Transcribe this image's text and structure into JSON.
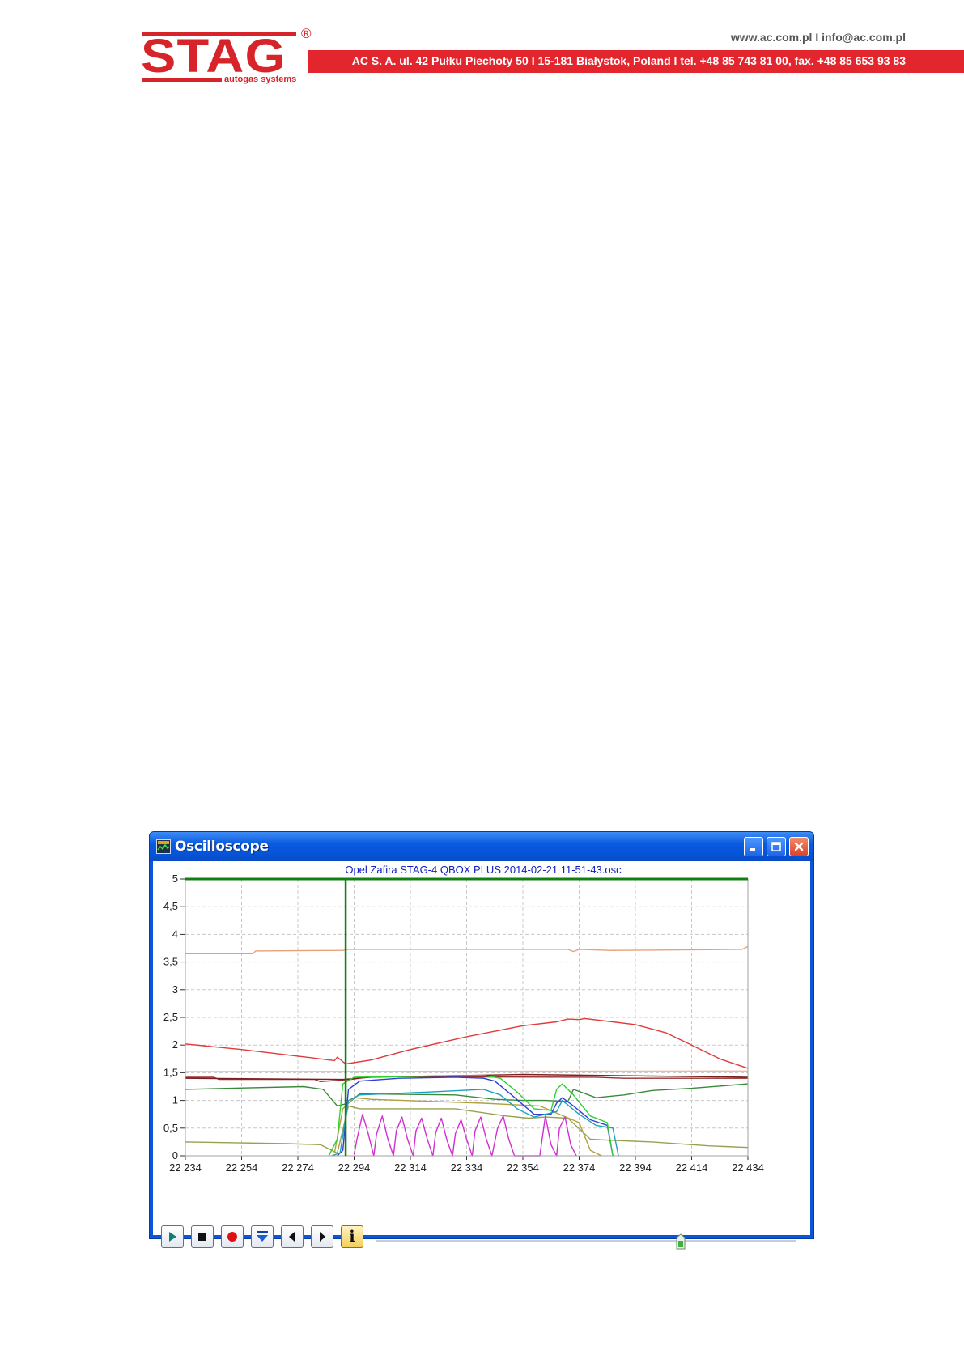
{
  "header": {
    "logo_text": "STAG",
    "logo_registered": "®",
    "logo_tagline": "autogas systems",
    "contact_line": "www.ac.com.pl I info@ac.com.pl",
    "address_line": "AC S. A. ul. 42 Pułku Piechoty 50 I 15-181 Białystok, Poland I tel. +48 85 743 81 00, fax. +48 85 653 93 83",
    "brand_color": "#e3262e"
  },
  "window": {
    "title": "Oscilloscope",
    "icon": "oscilloscope-app-icon",
    "buttons": [
      "minimize-icon",
      "maximize-icon",
      "close-icon"
    ]
  },
  "toolbar": {
    "icons": [
      "play-icon",
      "stop-icon",
      "record-icon",
      "download-icon",
      "step-back-icon",
      "step-forward-icon",
      "info-icon"
    ],
    "info_label": "i",
    "position_fraction": 0.725
  },
  "chart_data": {
    "type": "line",
    "title": "Opel Zafira STAG-4 QBOX PLUS 2014-02-21 11-51-43.osc",
    "xlim": [
      22234,
      22434
    ],
    "ylim": [
      0,
      5
    ],
    "x_ticks": [
      "22 234",
      "22 254",
      "22 274",
      "22 294",
      "22 314",
      "22 334",
      "22 354",
      "22 374",
      "22 394",
      "22 414",
      "22 434"
    ],
    "x_tick_values": [
      22234,
      22254,
      22274,
      22294,
      22314,
      22334,
      22354,
      22374,
      22394,
      22414,
      22434
    ],
    "y_ticks": [
      "0",
      "0,5",
      "1",
      "1,5",
      "2",
      "2,5",
      "3",
      "3,5",
      "4",
      "4,5",
      "5"
    ],
    "y_tick_values": [
      0,
      0.5,
      1,
      1.5,
      2,
      2.5,
      3,
      3.5,
      4,
      4.5,
      5
    ],
    "grid": true,
    "cursor_x": 22291,
    "series": [
      {
        "color": "#e8a078",
        "points": [
          [
            22234,
            3.65
          ],
          [
            22258,
            3.65
          ],
          [
            22259,
            3.7
          ],
          [
            22290,
            3.71
          ],
          [
            22292,
            3.73
          ],
          [
            22370,
            3.73
          ],
          [
            22372,
            3.69
          ],
          [
            22374,
            3.73
          ],
          [
            22385,
            3.71
          ],
          [
            22410,
            3.72
          ],
          [
            22432,
            3.73
          ],
          [
            22434,
            3.78
          ]
        ]
      },
      {
        "color": "#f0b8a0",
        "points": [
          [
            22234,
            1.52
          ],
          [
            22434,
            1.53
          ]
        ]
      },
      {
        "color": "#e03a3a",
        "points": [
          [
            22234,
            2.02
          ],
          [
            22254,
            1.92
          ],
          [
            22274,
            1.8
          ],
          [
            22287,
            1.72
          ],
          [
            22288,
            1.78
          ],
          [
            22291,
            1.66
          ],
          [
            22300,
            1.73
          ],
          [
            22314,
            1.92
          ],
          [
            22334,
            2.15
          ],
          [
            22354,
            2.35
          ],
          [
            22366,
            2.42
          ],
          [
            22370,
            2.47
          ],
          [
            22374,
            2.46
          ],
          [
            22376,
            2.48
          ],
          [
            22394,
            2.37
          ],
          [
            22405,
            2.22
          ],
          [
            22414,
            2.0
          ],
          [
            22424,
            1.75
          ],
          [
            22434,
            1.58
          ]
        ]
      },
      {
        "color": "#9a3030",
        "points": [
          [
            22234,
            1.42
          ],
          [
            22244,
            1.42
          ],
          [
            22246,
            1.38
          ],
          [
            22280,
            1.38
          ],
          [
            22282,
            1.34
          ],
          [
            22293,
            1.38
          ],
          [
            22300,
            1.43
          ],
          [
            22380,
            1.42
          ],
          [
            22390,
            1.4
          ],
          [
            22434,
            1.4
          ]
        ]
      },
      {
        "color": "#7a2020",
        "points": [
          [
            22234,
            1.4
          ],
          [
            22290,
            1.38
          ],
          [
            22300,
            1.42
          ],
          [
            22354,
            1.47
          ],
          [
            22400,
            1.44
          ],
          [
            22434,
            1.42
          ]
        ]
      },
      {
        "color": "#3a8a3a",
        "points": [
          [
            22234,
            1.2
          ],
          [
            22250,
            1.22
          ],
          [
            22276,
            1.25
          ],
          [
            22283,
            1.2
          ],
          [
            22288,
            0.9
          ],
          [
            22292,
            0.95
          ],
          [
            22296,
            1.12
          ],
          [
            22330,
            1.1
          ],
          [
            22344,
            1.02
          ],
          [
            22354,
            1.0
          ],
          [
            22362,
            1.0
          ],
          [
            22370,
            0.98
          ],
          [
            22372,
            1.2
          ],
          [
            22380,
            1.05
          ],
          [
            22390,
            1.1
          ],
          [
            22400,
            1.18
          ],
          [
            22414,
            1.22
          ],
          [
            22434,
            1.3
          ]
        ]
      },
      {
        "color": "#9aa050",
        "points": [
          [
            22234,
            0.25
          ],
          [
            22270,
            0.22
          ],
          [
            22282,
            0.2
          ],
          [
            22288,
            0.05
          ],
          [
            22292,
            0.9
          ],
          [
            22296,
            0.85
          ],
          [
            22330,
            0.85
          ],
          [
            22348,
            0.72
          ],
          [
            22356,
            0.68
          ],
          [
            22362,
            0.7
          ],
          [
            22370,
            0.68
          ],
          [
            22378,
            0.3
          ],
          [
            22385,
            0.28
          ],
          [
            22400,
            0.25
          ],
          [
            22420,
            0.18
          ],
          [
            22434,
            0.15
          ]
        ]
      },
      {
        "color": "#b0a040",
        "points": [
          [
            22287,
            0.05
          ],
          [
            22290,
            0.85
          ],
          [
            22294,
            1.05
          ],
          [
            22300,
            1.02
          ],
          [
            22340,
            0.95
          ],
          [
            22360,
            0.9
          ],
          [
            22374,
            0.6
          ],
          [
            22378,
            0.1
          ],
          [
            22382,
            0.0
          ]
        ]
      },
      {
        "color": "#2a40d8",
        "points": [
          [
            22288,
            0.0
          ],
          [
            22290,
            0.1
          ],
          [
            22292,
            1.2
          ],
          [
            22296,
            1.35
          ],
          [
            22310,
            1.4
          ],
          [
            22330,
            1.42
          ],
          [
            22340,
            1.4
          ],
          [
            22344,
            1.35
          ],
          [
            22350,
            1.1
          ],
          [
            22358,
            0.75
          ],
          [
            22364,
            0.75
          ],
          [
            22366,
            0.95
          ],
          [
            22368,
            1.05
          ],
          [
            22372,
            0.9
          ],
          [
            22378,
            0.65
          ],
          [
            22384,
            0.55
          ],
          [
            22386,
            0.0
          ]
        ]
      },
      {
        "color": "#1fa0c0",
        "points": [
          [
            22286,
            0.0
          ],
          [
            22289,
            0.05
          ],
          [
            22292,
            1.0
          ],
          [
            22296,
            1.1
          ],
          [
            22320,
            1.15
          ],
          [
            22340,
            1.2
          ],
          [
            22346,
            1.1
          ],
          [
            22352,
            0.85
          ],
          [
            22358,
            0.7
          ],
          [
            22366,
            0.8
          ],
          [
            22368,
            1.0
          ],
          [
            22374,
            0.75
          ],
          [
            22380,
            0.55
          ],
          [
            22386,
            0.5
          ],
          [
            22388,
            0.0
          ]
        ]
      },
      {
        "color": "#30d030",
        "points": [
          [
            22285,
            0.0
          ],
          [
            22288,
            0.3
          ],
          [
            22290,
            1.3
          ],
          [
            22294,
            1.42
          ],
          [
            22310,
            1.43
          ],
          [
            22330,
            1.45
          ],
          [
            22340,
            1.45
          ],
          [
            22346,
            1.4
          ],
          [
            22352,
            1.15
          ],
          [
            22358,
            0.85
          ],
          [
            22364,
            0.82
          ],
          [
            22366,
            1.2
          ],
          [
            22368,
            1.3
          ],
          [
            22372,
            1.1
          ],
          [
            22378,
            0.72
          ],
          [
            22384,
            0.6
          ],
          [
            22386,
            0.0
          ]
        ]
      },
      {
        "color": "#d030d0",
        "points": [
          [
            22294,
            0.02
          ],
          [
            22295,
            0.3
          ],
          [
            22297,
            0.75
          ],
          [
            22299,
            0.4
          ],
          [
            22301,
            0.0
          ],
          [
            22302,
            0.4
          ],
          [
            22304,
            0.72
          ],
          [
            22306,
            0.3
          ],
          [
            22308,
            0.0
          ],
          [
            22309,
            0.45
          ],
          [
            22311,
            0.7
          ],
          [
            22313,
            0.3
          ],
          [
            22315,
            0.0
          ],
          [
            22316,
            0.45
          ],
          [
            22318,
            0.68
          ],
          [
            22320,
            0.3
          ],
          [
            22322,
            0.0
          ],
          [
            22323,
            0.42
          ],
          [
            22325,
            0.68
          ],
          [
            22327,
            0.28
          ],
          [
            22329,
            0.0
          ],
          [
            22330,
            0.4
          ],
          [
            22332,
            0.65
          ],
          [
            22334,
            0.3
          ],
          [
            22336,
            0.0
          ],
          [
            22337,
            0.45
          ],
          [
            22339,
            0.7
          ],
          [
            22341,
            0.3
          ],
          [
            22343,
            0.0
          ],
          [
            22345,
            0.5
          ],
          [
            22347,
            0.72
          ],
          [
            22349,
            0.3
          ],
          [
            22351,
            0.0
          ],
          [
            22360,
            0.0
          ],
          [
            22362,
            0.72
          ],
          [
            22364,
            0.2
          ],
          [
            22366,
            0.0
          ],
          [
            22367,
            0.5
          ],
          [
            22369,
            0.7
          ],
          [
            22371,
            0.2
          ],
          [
            22373,
            0.0
          ]
        ]
      }
    ]
  }
}
